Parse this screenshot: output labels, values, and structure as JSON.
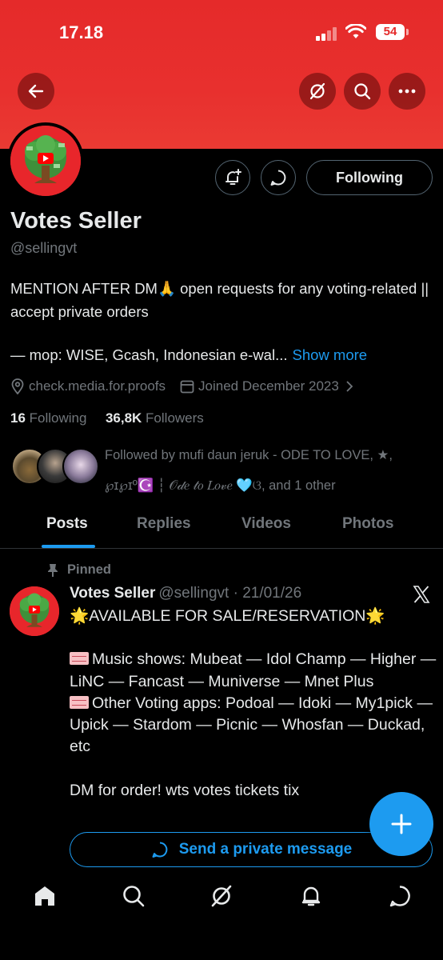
{
  "status_bar": {
    "time": "17.18",
    "battery": "54"
  },
  "profile": {
    "name": "Votes Seller",
    "handle": "@sellingvt",
    "following_button": "Following",
    "bio_lines": [
      "MENTION AFTER DM🙏 open requests for any voting-related || accept private orders"
    ],
    "bio_line3": "— mop: WISE, Gcash, Indonesian e-wal...",
    "show_more": "Show more",
    "website": "check.media.for.proofs",
    "joined": "Joined December 2023",
    "following_count": "16",
    "following_label": "Following",
    "followers_count": "36,8K",
    "followers_label": "Followers",
    "followed_by": "Followed by mufi daun jeruk - ODE TO LOVE, ★, ℘ɪ℘ɪº☪️ ┆ 𝒪𝒹𝑒 𝓉𝑜 𝐿𝑜𝓋𝑒 🩵ଓ, and 1 other"
  },
  "tabs": [
    {
      "label": "Posts",
      "active": true
    },
    {
      "label": "Replies",
      "active": false
    },
    {
      "label": "Videos",
      "active": false
    },
    {
      "label": "Photos",
      "active": false
    }
  ],
  "post": {
    "pinned_label": "Pinned",
    "author": "Votes Seller",
    "meta": "@sellingvt · 21/01/26",
    "line1": "AVAILABLE FOR SALE/RESERVATION",
    "music_shows": "Music shows: Mubeat — Idol Champ — Higher — LiNC — Fancast — Muniverse — Mnet Plus",
    "other_apps": "Other Voting apps: Podoal — Idoki — My1pick — Upick — Stardom — Picnic — Whosfan — Duckad, etc",
    "closing": "DM for order! wts votes tickets tix",
    "dm_button": "Send a private message"
  },
  "colors": {
    "accent": "#1d9bf0",
    "banner": "#e52a2a",
    "muted": "#71767b"
  },
  "icons": [
    "back-arrow-icon",
    "grok-icon",
    "search-icon",
    "more-icon",
    "bell-plus-icon",
    "message-icon",
    "location-icon",
    "calendar-icon",
    "pin-icon",
    "x-logo-icon",
    "plus-icon",
    "home-icon",
    "search-nav-icon",
    "grok-nav-icon",
    "bell-icon",
    "mail-icon"
  ]
}
